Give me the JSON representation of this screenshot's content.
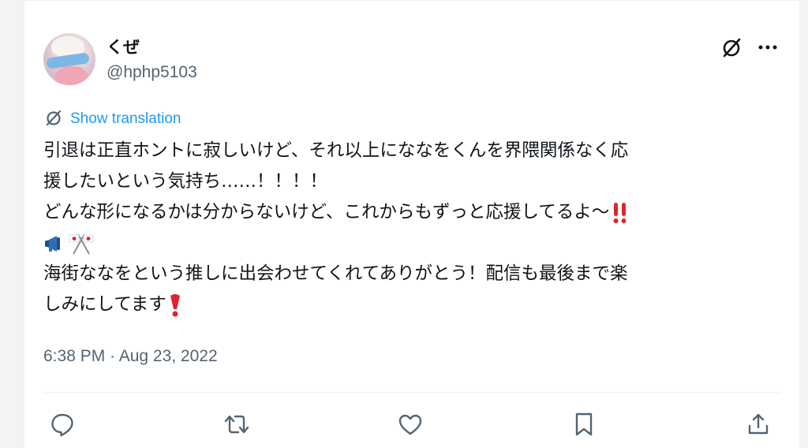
{
  "tweet": {
    "author": {
      "display_name": "くぜ",
      "handle": "@hphp5103",
      "avatar_icon": "avatar-image"
    },
    "translate_label": "Show translation",
    "text_lines": [
      "引退は正直ホントに寂しいけど、それ以上にななをくんを界隈関係なく応",
      "援したいという気持ち……！！！！",
      "どんな形になるかは分からないけど、これからもずっと応援してるよ〜",
      "",
      "海街ななをという推しに出会わせてくれてありがとう！配信も最後まで楽",
      "しみにしてます"
    ],
    "emojis": {
      "line3": "double-exclamation-icon",
      "line4": [
        "megaphone-icon",
        "crossed-flags-icon"
      ],
      "line6": "heavy-exclamation-icon"
    },
    "timestamp": "6:38 PM · Aug 23, 2022"
  },
  "actions": {
    "reply": "reply-icon",
    "retweet": "retweet-icon",
    "like": "like-icon",
    "bookmark": "bookmark-icon",
    "share": "share-icon"
  },
  "colors": {
    "link": "#1d9bf0",
    "secondary_text": "#536471",
    "primary_text": "#0f1419",
    "icon": "#536471",
    "emoji_red": "#e0242e"
  }
}
